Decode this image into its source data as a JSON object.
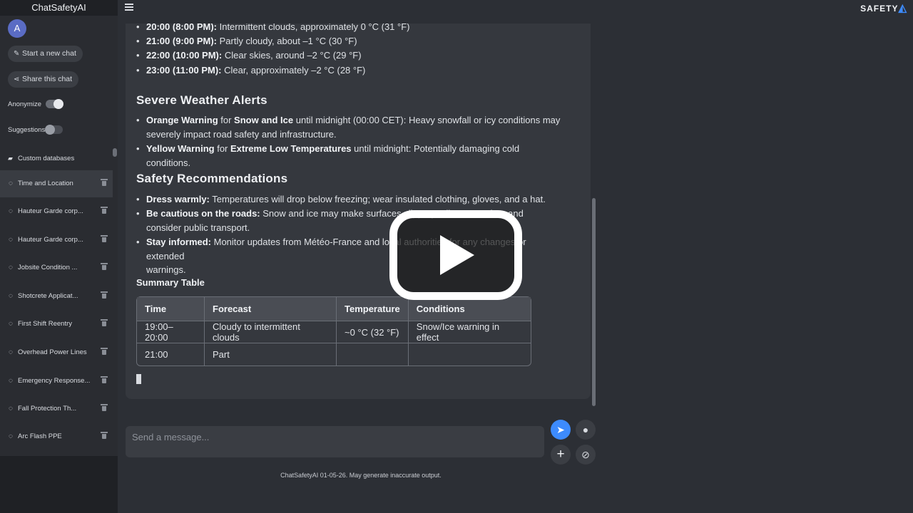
{
  "sidebar": {
    "title": "ChatSafetyAI",
    "avatar_initial": "A",
    "new_chat_label": "Start a new chat",
    "share_chat_label": "Share this chat",
    "anonymize_label": "Anonymize",
    "anonymize_on": true,
    "suggestions_label": "Suggestions",
    "suggestions_on": false,
    "custom_db_label": "Custom databases",
    "chats": [
      {
        "label": "Time and Location",
        "active": true
      },
      {
        "label": "Hauteur Garde corp...",
        "active": false
      },
      {
        "label": "Hauteur Garde corp...",
        "active": false
      },
      {
        "label": "Jobsite Condition ...",
        "active": false
      },
      {
        "label": "Shotcrete Applicat...",
        "active": false
      },
      {
        "label": "First Shift Reentry",
        "active": false
      },
      {
        "label": "Overhead Power Lines",
        "active": false
      },
      {
        "label": "Emergency Response...",
        "active": false
      },
      {
        "label": "Fall Protection Th...",
        "active": false
      },
      {
        "label": "Arc Flash PPE",
        "active": false
      }
    ]
  },
  "brand": {
    "text": "SAFETY",
    "accent_color": "#3d8bfd"
  },
  "message": {
    "hourly": [
      {
        "time": "20:00 (8:00 PM):",
        "text": " Intermittent clouds, approximately 0 °C (31 °F)"
      },
      {
        "time": "21:00 (9:00 PM):",
        "text": " Partly cloudy, about –1 °C (30 °F)"
      },
      {
        "time": "22:00 (10:00 PM):",
        "text": " Clear skies, around –2 °C (29 °F)"
      },
      {
        "time": "23:00 (11:00 PM):",
        "text": " Clear, approximately –2 °C (28 °F)"
      }
    ],
    "alerts_heading": "Severe Weather Alerts",
    "alerts": {
      "a1_bold1": "Orange Warning",
      "a1_mid": " for ",
      "a1_bold2": "Snow and Ice",
      "a1_line1_rest": " until midnight (00:00 CET): Heavy snowfall or icy conditions may",
      "a1_line2": "severely impact road safety and infrastructure.",
      "a2_bold1": "Yellow Warning",
      "a2_mid": " for ",
      "a2_bold2": "Extreme Low Temperatures",
      "a2_rest": " until midnight: Potentially damaging cold conditions."
    },
    "safety_heading": "Safety Recommendations",
    "safety": {
      "s1_bold": "Dress warmly:",
      "s1_rest": " Temperatures will drop below freezing; wear insulated clothing, gloves, and a hat.",
      "s2_bold": "Be cautious on the roads:",
      "s2_line1_rest": " Snow and ice may make surfaces slippery; allow extra time and",
      "s2_line2": "consider public transport.",
      "s3_bold": "Stay informed:",
      "s3_line1_rest": " Monitor updates from Météo-France and local authorities for any changes or extended",
      "s3_line2": "warnings."
    },
    "table_heading": "Summary Table",
    "table": {
      "headers": [
        "Time",
        "Forecast",
        "Temperature",
        "Conditions"
      ],
      "rows": [
        [
          "19:00–20:00",
          "Cloudy to intermittent clouds",
          "~0 °C (32 °F)",
          "Snow/Ice warning in effect"
        ],
        [
          "21:00",
          "Part",
          "",
          ""
        ]
      ]
    }
  },
  "input": {
    "placeholder": "Send a message..."
  },
  "footer": "ChatSafetyAI 01-05-26. May generate inaccurate output."
}
